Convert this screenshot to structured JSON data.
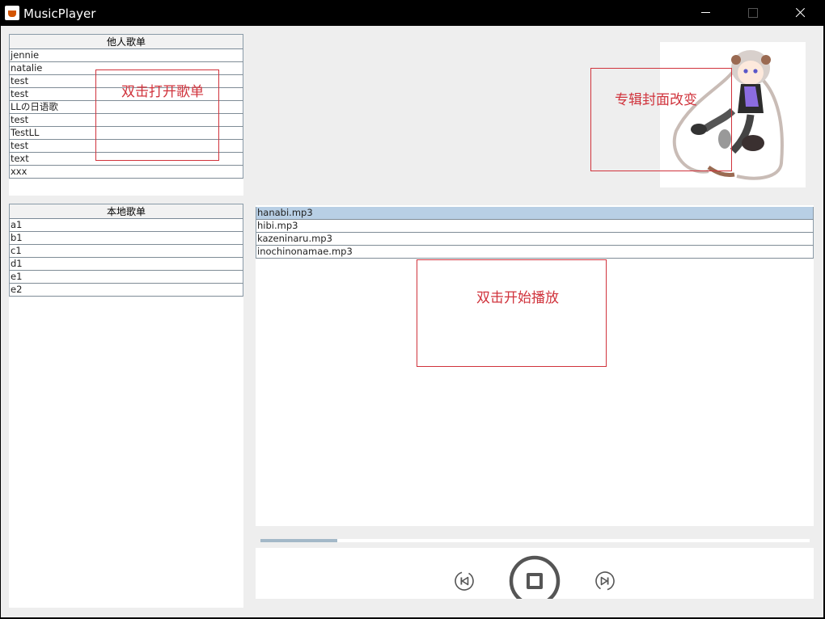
{
  "window": {
    "title": "MusicPlayer"
  },
  "others_playlists": {
    "header": "他人歌单",
    "items": [
      "jennie",
      "natalie",
      "test",
      "test",
      "LLの日语歌",
      "test",
      "TestLL",
      "test",
      "text",
      "xxx"
    ]
  },
  "local_playlists": {
    "header": "本地歌单",
    "items": [
      "a1",
      "b1",
      "c1",
      "d1",
      "e1",
      "e2"
    ]
  },
  "songs": {
    "items": [
      "hanabi.mp3",
      "hibi.mp3",
      "kazeninaru.mp3",
      "inochinonamae.mp3"
    ],
    "selected_index": 0
  },
  "annotations": {
    "playlist_hint": "双击打开歌单",
    "cover_hint": "专辑封面改变",
    "song_hint": "双击开始播放"
  },
  "progress": {
    "fraction": 0.14
  },
  "controls": {
    "previous_icon": "skip-previous-icon",
    "stop_icon": "stop-icon",
    "next_icon": "skip-next-icon"
  },
  "colors": {
    "annotation": "#d0333c",
    "selected_row": "#b8cfe5",
    "progress_fill": "#a3b8c8"
  }
}
